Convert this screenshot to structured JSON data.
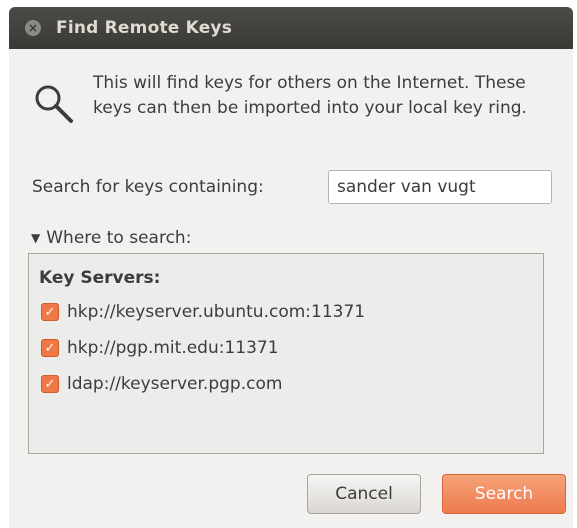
{
  "window": {
    "title": "Find Remote Keys",
    "close_glyph": "×"
  },
  "intro": {
    "icon": "magnifier-icon",
    "text": "This will find keys for others on the Internet. These keys can then be imported into your local key ring."
  },
  "search": {
    "label": "Search for keys containing:",
    "value": "sander van vugt"
  },
  "where": {
    "expander_glyph": "▼",
    "label": "Where to search:",
    "expanded": true
  },
  "key_servers": {
    "heading": "Key Servers:",
    "items": [
      {
        "label": "hkp://keyserver.ubuntu.com:11371",
        "checked": true
      },
      {
        "label": "hkp://pgp.mit.edu:11371",
        "checked": true
      },
      {
        "label": "ldap://keyserver.pgp.com",
        "checked": true
      }
    ],
    "check_glyph": "✓",
    "check_color": "#f07746"
  },
  "buttons": {
    "cancel_label": "Cancel",
    "search_label": "Search",
    "accent_color": "#ef7d51"
  }
}
